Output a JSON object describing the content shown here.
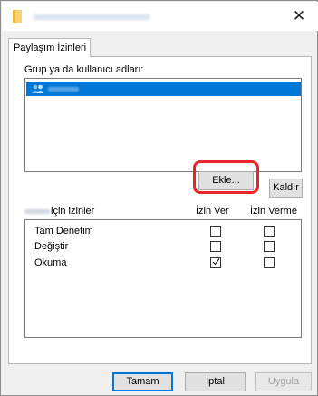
{
  "tabs": [
    {
      "label": "Paylaşım İzinleri"
    }
  ],
  "group_list": {
    "label": "Grup ya da kullanıcı adları:"
  },
  "buttons": {
    "add": "Ekle...",
    "remove": "Kaldır",
    "ok": "Tamam",
    "cancel": "İptal",
    "apply": "Uygula"
  },
  "permissions": {
    "header_suffix": "için izinler",
    "allow_header": "İzin Ver",
    "deny_header": "İzin Verme",
    "rows": [
      {
        "name": "Tam Denetim",
        "allow": false,
        "deny": false
      },
      {
        "name": "Değiştir",
        "allow": false,
        "deny": false
      },
      {
        "name": "Okuma",
        "allow": true,
        "deny": false
      }
    ]
  },
  "colors": {
    "selection": "#0078d7",
    "highlight": "#e8262a"
  }
}
